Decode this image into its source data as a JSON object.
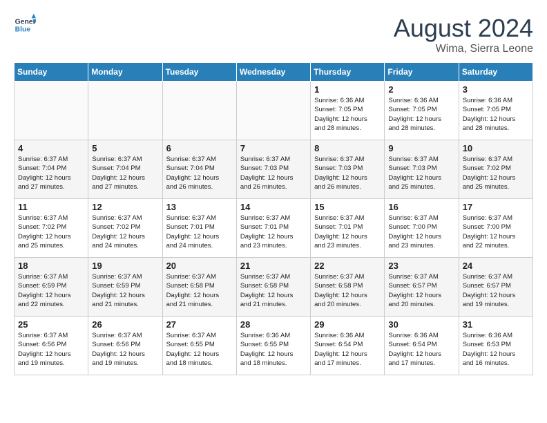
{
  "header": {
    "logo_line1": "General",
    "logo_line2": "Blue",
    "month_year": "August 2024",
    "location": "Wima, Sierra Leone"
  },
  "weekdays": [
    "Sunday",
    "Monday",
    "Tuesday",
    "Wednesday",
    "Thursday",
    "Friday",
    "Saturday"
  ],
  "weeks": [
    [
      {
        "day": "",
        "info": ""
      },
      {
        "day": "",
        "info": ""
      },
      {
        "day": "",
        "info": ""
      },
      {
        "day": "",
        "info": ""
      },
      {
        "day": "1",
        "info": "Sunrise: 6:36 AM\nSunset: 7:05 PM\nDaylight: 12 hours\nand 28 minutes."
      },
      {
        "day": "2",
        "info": "Sunrise: 6:36 AM\nSunset: 7:05 PM\nDaylight: 12 hours\nand 28 minutes."
      },
      {
        "day": "3",
        "info": "Sunrise: 6:36 AM\nSunset: 7:05 PM\nDaylight: 12 hours\nand 28 minutes."
      }
    ],
    [
      {
        "day": "4",
        "info": "Sunrise: 6:37 AM\nSunset: 7:04 PM\nDaylight: 12 hours\nand 27 minutes."
      },
      {
        "day": "5",
        "info": "Sunrise: 6:37 AM\nSunset: 7:04 PM\nDaylight: 12 hours\nand 27 minutes."
      },
      {
        "day": "6",
        "info": "Sunrise: 6:37 AM\nSunset: 7:04 PM\nDaylight: 12 hours\nand 26 minutes."
      },
      {
        "day": "7",
        "info": "Sunrise: 6:37 AM\nSunset: 7:03 PM\nDaylight: 12 hours\nand 26 minutes."
      },
      {
        "day": "8",
        "info": "Sunrise: 6:37 AM\nSunset: 7:03 PM\nDaylight: 12 hours\nand 26 minutes."
      },
      {
        "day": "9",
        "info": "Sunrise: 6:37 AM\nSunset: 7:03 PM\nDaylight: 12 hours\nand 25 minutes."
      },
      {
        "day": "10",
        "info": "Sunrise: 6:37 AM\nSunset: 7:02 PM\nDaylight: 12 hours\nand 25 minutes."
      }
    ],
    [
      {
        "day": "11",
        "info": "Sunrise: 6:37 AM\nSunset: 7:02 PM\nDaylight: 12 hours\nand 25 minutes."
      },
      {
        "day": "12",
        "info": "Sunrise: 6:37 AM\nSunset: 7:02 PM\nDaylight: 12 hours\nand 24 minutes."
      },
      {
        "day": "13",
        "info": "Sunrise: 6:37 AM\nSunset: 7:01 PM\nDaylight: 12 hours\nand 24 minutes."
      },
      {
        "day": "14",
        "info": "Sunrise: 6:37 AM\nSunset: 7:01 PM\nDaylight: 12 hours\nand 23 minutes."
      },
      {
        "day": "15",
        "info": "Sunrise: 6:37 AM\nSunset: 7:01 PM\nDaylight: 12 hours\nand 23 minutes."
      },
      {
        "day": "16",
        "info": "Sunrise: 6:37 AM\nSunset: 7:00 PM\nDaylight: 12 hours\nand 23 minutes."
      },
      {
        "day": "17",
        "info": "Sunrise: 6:37 AM\nSunset: 7:00 PM\nDaylight: 12 hours\nand 22 minutes."
      }
    ],
    [
      {
        "day": "18",
        "info": "Sunrise: 6:37 AM\nSunset: 6:59 PM\nDaylight: 12 hours\nand 22 minutes."
      },
      {
        "day": "19",
        "info": "Sunrise: 6:37 AM\nSunset: 6:59 PM\nDaylight: 12 hours\nand 21 minutes."
      },
      {
        "day": "20",
        "info": "Sunrise: 6:37 AM\nSunset: 6:58 PM\nDaylight: 12 hours\nand 21 minutes."
      },
      {
        "day": "21",
        "info": "Sunrise: 6:37 AM\nSunset: 6:58 PM\nDaylight: 12 hours\nand 21 minutes."
      },
      {
        "day": "22",
        "info": "Sunrise: 6:37 AM\nSunset: 6:58 PM\nDaylight: 12 hours\nand 20 minutes."
      },
      {
        "day": "23",
        "info": "Sunrise: 6:37 AM\nSunset: 6:57 PM\nDaylight: 12 hours\nand 20 minutes."
      },
      {
        "day": "24",
        "info": "Sunrise: 6:37 AM\nSunset: 6:57 PM\nDaylight: 12 hours\nand 19 minutes."
      }
    ],
    [
      {
        "day": "25",
        "info": "Sunrise: 6:37 AM\nSunset: 6:56 PM\nDaylight: 12 hours\nand 19 minutes."
      },
      {
        "day": "26",
        "info": "Sunrise: 6:37 AM\nSunset: 6:56 PM\nDaylight: 12 hours\nand 19 minutes."
      },
      {
        "day": "27",
        "info": "Sunrise: 6:37 AM\nSunset: 6:55 PM\nDaylight: 12 hours\nand 18 minutes."
      },
      {
        "day": "28",
        "info": "Sunrise: 6:36 AM\nSunset: 6:55 PM\nDaylight: 12 hours\nand 18 minutes."
      },
      {
        "day": "29",
        "info": "Sunrise: 6:36 AM\nSunset: 6:54 PM\nDaylight: 12 hours\nand 17 minutes."
      },
      {
        "day": "30",
        "info": "Sunrise: 6:36 AM\nSunset: 6:54 PM\nDaylight: 12 hours\nand 17 minutes."
      },
      {
        "day": "31",
        "info": "Sunrise: 6:36 AM\nSunset: 6:53 PM\nDaylight: 12 hours\nand 16 minutes."
      }
    ]
  ]
}
